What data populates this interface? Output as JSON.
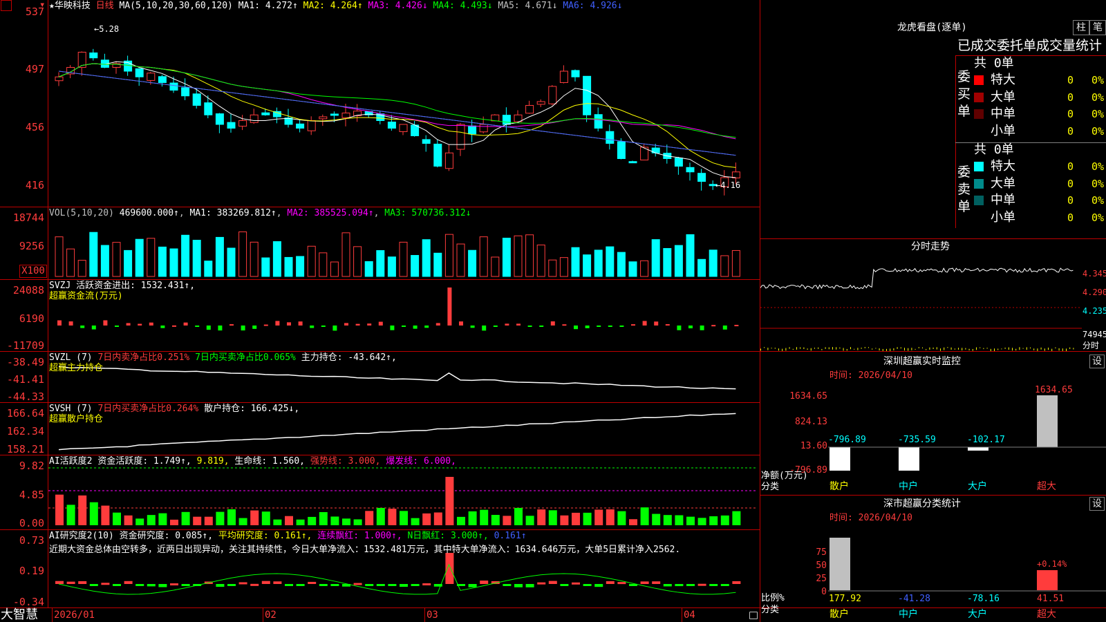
{
  "stock": {
    "star": "★",
    "name": "华映科技",
    "period": "日线",
    "ma_label": "MA(5,10,20,30,60,120)",
    "ma": [
      {
        "label": "MA1:",
        "value": "4.272↑",
        "color": "#ffffff"
      },
      {
        "label": "MA2:",
        "value": "4.264↑",
        "color": "#ffff00"
      },
      {
        "label": "MA3:",
        "value": "4.426↓",
        "color": "#ff00ff"
      },
      {
        "label": "MA4:",
        "value": "4.493↓",
        "color": "#00ff00"
      },
      {
        "label": "MA5:",
        "value": "4.671↓",
        "color": "#c0c0c0"
      },
      {
        "label": "MA6:",
        "value": "4.926↓",
        "color": "#4060ff"
      }
    ],
    "high_mark": "5.28",
    "low_mark": "4.16"
  },
  "price_axis": [
    "537",
    "497",
    "456",
    "416"
  ],
  "volume": {
    "label": "VOL(5,10,20)",
    "value": "469600.000↑",
    "ma1": "MA1: 383269.812↑",
    "ma2": "MA2: 385525.094↑",
    "ma3": "MA3: 570736.312↓",
    "axis": [
      "18744",
      "9256",
      "X100"
    ]
  },
  "svzj": {
    "line1": "SVZJ  活跃资金进出: 1532.431↑,",
    "line2": "超赢资金流(万元)",
    "axis": [
      "24088",
      "6190",
      "-11709"
    ]
  },
  "svzl": {
    "name": "SVZL (7)",
    "t1": "7日内卖净占比0.251%",
    "t2": "7日内买卖净占比0.065%",
    "t3": "主力持仓: -43.642↑,",
    "line2": "超赢主力持仓",
    "axis": [
      "-38.49",
      "-41.41",
      "-44.33"
    ]
  },
  "svsh": {
    "name": "SVSH (7)",
    "t1": "7日内买卖净占比0.264%",
    "t2": "散户持仓: 166.425↓,",
    "line2": "超赢散户持仓",
    "axis": [
      "166.64",
      "162.34",
      "158.21"
    ]
  },
  "ai_active": {
    "name": "AI活跃度2",
    "t1": "资金活跃度: 1.749↑,",
    "t2": "9.819,",
    "t3": "生命线: 1.560,",
    "t4": "强势线: 3.000,",
    "t5": "爆发线: 6.000,",
    "axis": [
      "9.82",
      "4.85",
      "0.00"
    ]
  },
  "ai_research": {
    "name": "AI研究度2(10)",
    "t1": "资金研究度: 0.085↑,",
    "t2": "平均研究度: 0.161↑,",
    "t3": "连续飘红: 1.000↑,",
    "t4": "N日飘红: 3.000↑,",
    "t5": "0.161↑",
    "comment": "近期大资金总体由空转多，近两日出现异动，关注其持续性，今日大单净流入：1532.481万元，其中特大单净流入：1634.646万元，大单5日累计净入2562.",
    "axis": [
      "0.73",
      "0.19",
      "-0.34"
    ]
  },
  "dates": [
    "2026/01",
    "02",
    "03",
    "04"
  ],
  "brand": "大智慧",
  "right": {
    "lhb_title": "龙虎看盘(逐单)",
    "btn_zhu": "柱",
    "btn_bi": "笔",
    "tabs_text": "已成交委托单成交量统计",
    "buy": {
      "vertical": [
        "委",
        "买",
        "单"
      ],
      "total": "共 0单",
      "rows": [
        {
          "name": "特大",
          "count": "0",
          "pct": "0%",
          "color": "#ff0000"
        },
        {
          "name": "大单",
          "count": "0",
          "pct": "0%",
          "color": "#a00000"
        },
        {
          "name": "中单",
          "count": "0",
          "pct": "0%",
          "color": "#600000"
        },
        {
          "name": "小单",
          "count": "0",
          "pct": "0%",
          "color": "#000000"
        }
      ]
    },
    "sell": {
      "vertical": [
        "委",
        "卖",
        "单"
      ],
      "total": "共 0单",
      "rows": [
        {
          "name": "特大",
          "count": "0",
          "pct": "0%",
          "color": "#00ffff"
        },
        {
          "name": "大单",
          "count": "0",
          "pct": "0%",
          "color": "#008b8b"
        },
        {
          "name": "中单",
          "count": "0",
          "pct": "0%",
          "color": "#006060"
        },
        {
          "name": "小单",
          "count": "0",
          "pct": "0%",
          "color": "#000000"
        }
      ]
    },
    "fenshi": {
      "title": "分时走势",
      "axis": [
        "4.345",
        "4.290",
        "4.235",
        "74945"
      ],
      "unit": "分时"
    },
    "sz_monitor": {
      "title": "深圳超赢实时监控",
      "btn": "设",
      "time": "时间: 2026/04/10",
      "axis": [
        "1634.65",
        "824.13",
        "13.60",
        "-796.89"
      ],
      "ylabel": "净额(万元)",
      "xlabel": "分类",
      "categories": [
        "散户",
        "中户",
        "大户",
        "超大"
      ],
      "values": [
        "-796.89",
        "-735.59",
        "-102.17",
        "1634.65"
      ]
    },
    "sz_stats": {
      "title": "深市超赢分类统计",
      "btn": "设",
      "time": "时间: 2026/04/10",
      "axis": [
        "75",
        "50",
        "25",
        "0"
      ],
      "ylabel": "比例%",
      "xlabel": "分类",
      "categories": [
        "散户",
        "中户",
        "大户",
        "超大"
      ],
      "values": [
        "177.92",
        "-41.28",
        "-78.16",
        "41.51"
      ],
      "top_label": "+0.14%"
    }
  }
}
